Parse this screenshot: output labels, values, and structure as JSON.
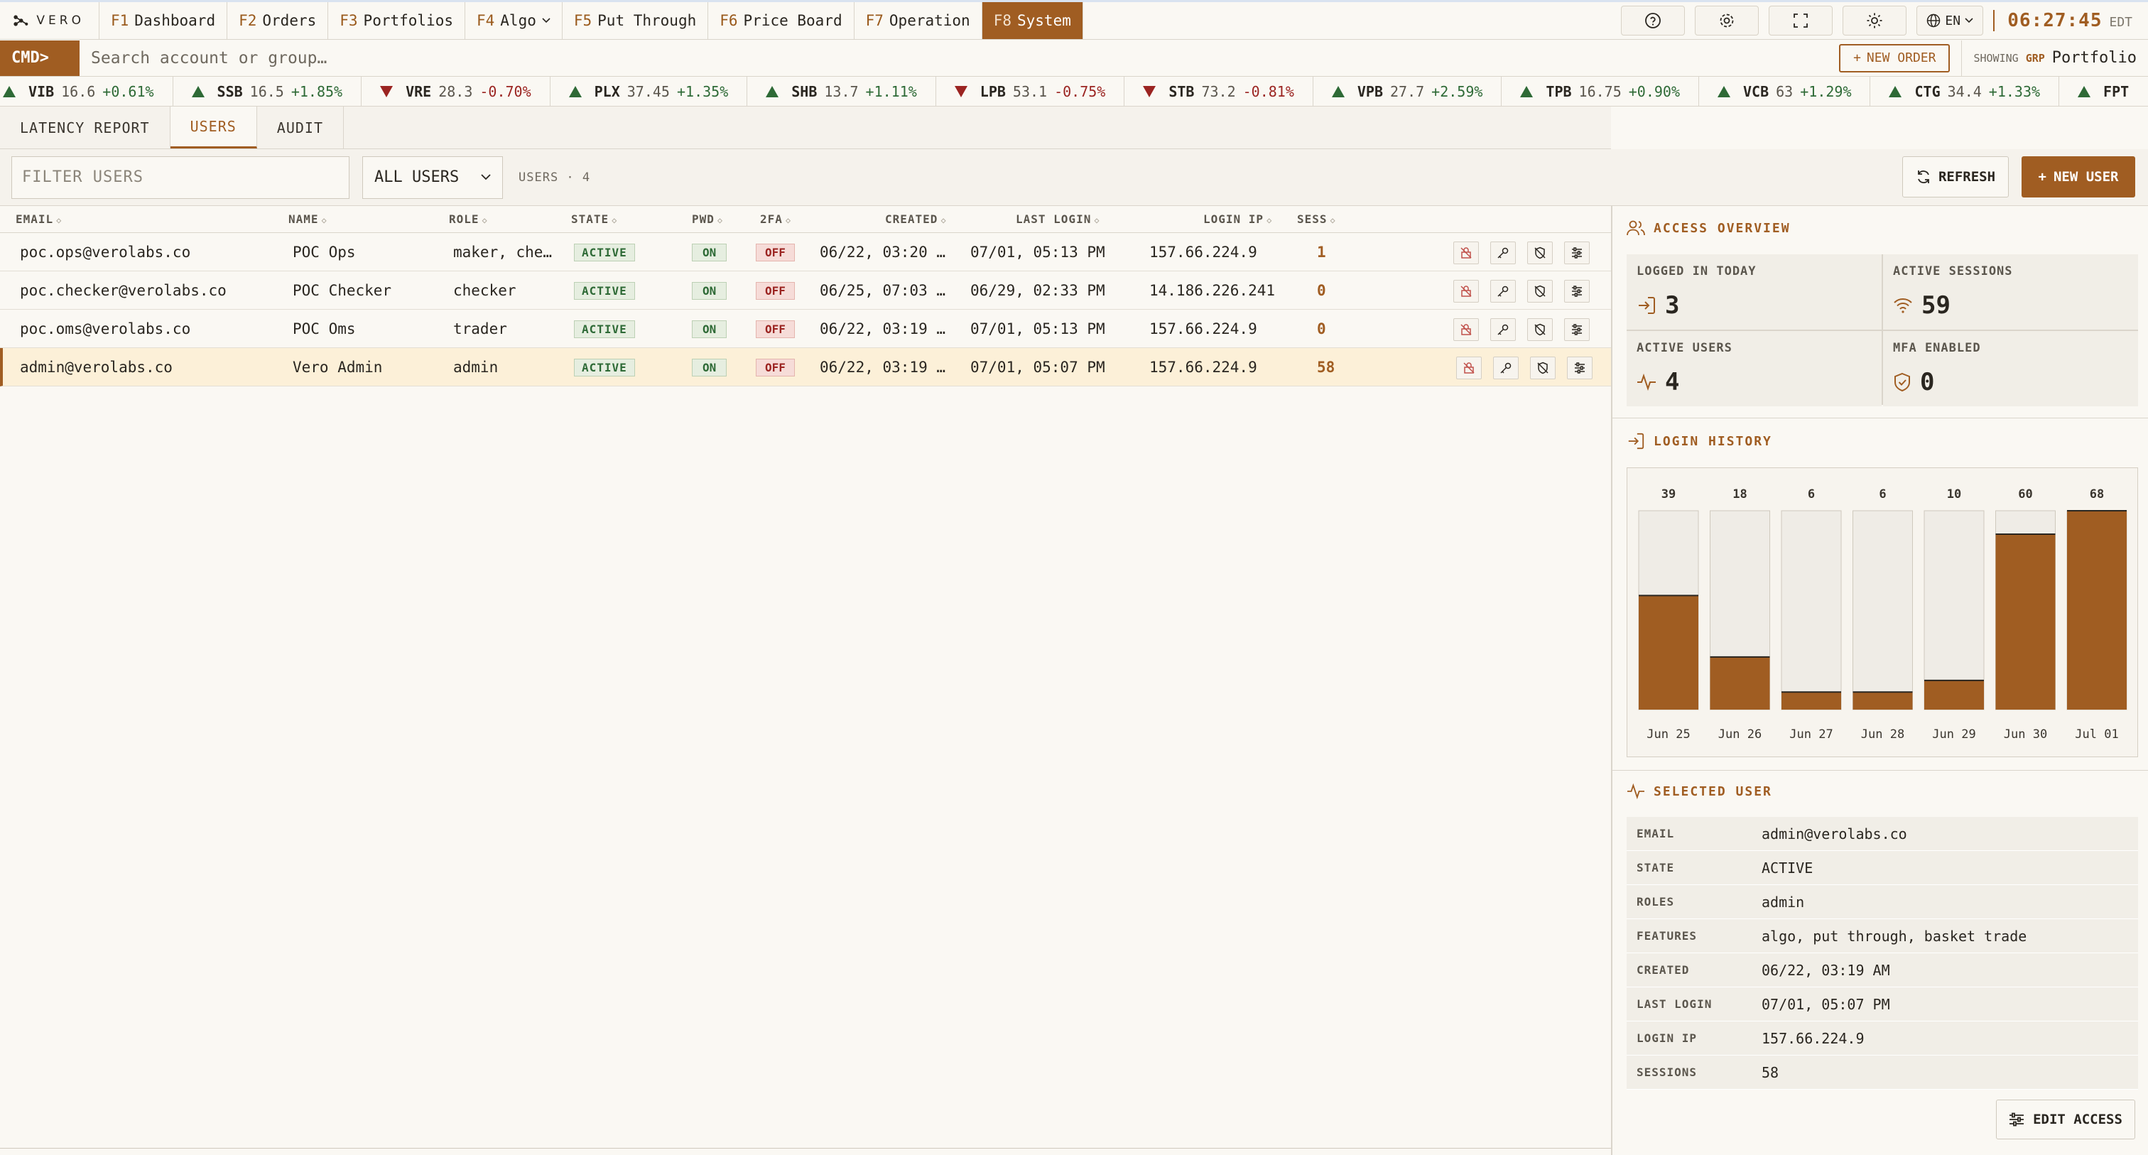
{
  "app": {
    "logo_text": "VERO"
  },
  "nav": {
    "tabs": [
      {
        "key": "F1",
        "label": "Dashboard"
      },
      {
        "key": "F2",
        "label": "Orders"
      },
      {
        "key": "F3",
        "label": "Portfolios"
      },
      {
        "key": "F4",
        "label": "Algo"
      },
      {
        "key": "F5",
        "label": "Put Through"
      },
      {
        "key": "F6",
        "label": "Price Board"
      },
      {
        "key": "F7",
        "label": "Operation"
      },
      {
        "key": "F8",
        "label": "System"
      }
    ],
    "language": "EN",
    "time": "06:27:45",
    "timezone": "EDT"
  },
  "cmd": {
    "label": "CMD>",
    "placeholder": "Search account or group…",
    "new_order": "NEW ORDER",
    "showing_label": "SHOWING",
    "showing_grp": "GRP",
    "showing_value": "Portfolio"
  },
  "ticker": [
    {
      "sym": "VIB",
      "px": "16.6",
      "chg": "+0.61%",
      "dir": "up"
    },
    {
      "sym": "SSB",
      "px": "16.5",
      "chg": "+1.85%",
      "dir": "up"
    },
    {
      "sym": "VRE",
      "px": "28.3",
      "chg": "-0.70%",
      "dir": "down"
    },
    {
      "sym": "PLX",
      "px": "37.45",
      "chg": "+1.35%",
      "dir": "up"
    },
    {
      "sym": "SHB",
      "px": "13.7",
      "chg": "+1.11%",
      "dir": "up"
    },
    {
      "sym": "LPB",
      "px": "53.1",
      "chg": "-0.75%",
      "dir": "down"
    },
    {
      "sym": "STB",
      "px": "73.2",
      "chg": "-0.81%",
      "dir": "down"
    },
    {
      "sym": "VPB",
      "px": "27.7",
      "chg": "+2.59%",
      "dir": "up"
    },
    {
      "sym": "TPB",
      "px": "16.75",
      "chg": "+0.90%",
      "dir": "up"
    },
    {
      "sym": "VCB",
      "px": "63",
      "chg": "+1.29%",
      "dir": "up"
    },
    {
      "sym": "CTG",
      "px": "34.4",
      "chg": "+1.33%",
      "dir": "up"
    },
    {
      "sym": "FPT",
      "px": "",
      "chg": "",
      "dir": "up"
    }
  ],
  "subtabs": [
    "LATENCY REPORT",
    "USERS",
    "AUDIT"
  ],
  "filter": {
    "placeholder": "FILTER USERS",
    "select_value": "ALL USERS",
    "count_text": "USERS · 4",
    "refresh": "REFRESH",
    "new_user": "NEW USER"
  },
  "table": {
    "headers": [
      "EMAIL",
      "NAME",
      "ROLE",
      "STATE",
      "PWD",
      "2FA",
      "CREATED",
      "LAST LOGIN",
      "LOGIN IP",
      "SESS"
    ],
    "rows": [
      {
        "email": "poc.ops@verolabs.co",
        "name": "POC Ops",
        "role": "maker, che…",
        "state": "ACTIVE",
        "pwd": "ON",
        "tfa": "OFF",
        "created": "06/22, 03:20 …",
        "last_login": "07/01, 05:13 PM",
        "ip": "157.66.224.9",
        "sess": "1"
      },
      {
        "email": "poc.checker@verolabs.co",
        "name": "POC Checker",
        "role": "checker",
        "state": "ACTIVE",
        "pwd": "ON",
        "tfa": "OFF",
        "created": "06/25, 07:03 …",
        "last_login": "06/29, 02:33 PM",
        "ip": "14.186.226.241",
        "sess": "0"
      },
      {
        "email": "poc.oms@verolabs.co",
        "name": "POC Oms",
        "role": "trader",
        "state": "ACTIVE",
        "pwd": "ON",
        "tfa": "OFF",
        "created": "06/22, 03:19 …",
        "last_login": "07/01, 05:13 PM",
        "ip": "157.66.224.9",
        "sess": "0"
      },
      {
        "email": "admin@verolabs.co",
        "name": "Vero Admin",
        "role": "admin",
        "state": "ACTIVE",
        "pwd": "ON",
        "tfa": "OFF",
        "created": "06/22, 03:19 …",
        "last_login": "07/01, 05:07 PM",
        "ip": "157.66.224.9",
        "sess": "58"
      }
    ],
    "selected_index": 3
  },
  "overview": {
    "title": "ACCESS OVERVIEW",
    "stats": [
      {
        "label": "LOGGED IN TODAY",
        "value": "3",
        "icon": "login-icon"
      },
      {
        "label": "ACTIVE SESSIONS",
        "value": "59",
        "icon": "wifi-icon"
      },
      {
        "label": "ACTIVE USERS",
        "value": "4",
        "icon": "pulse-icon"
      },
      {
        "label": "MFA ENABLED",
        "value": "0",
        "icon": "shield-icon"
      }
    ]
  },
  "history": {
    "title": "LOGIN HISTORY"
  },
  "chart_data": {
    "type": "bar",
    "categories": [
      "Jun 25",
      "Jun 26",
      "Jun 27",
      "Jun 28",
      "Jun 29",
      "Jun 30",
      "Jul 01"
    ],
    "values": [
      39,
      18,
      6,
      6,
      10,
      60,
      68
    ],
    "ylim": [
      0,
      68
    ],
    "title": "LOGIN HISTORY",
    "xlabel": "",
    "ylabel": "",
    "grid": false
  },
  "selected_user": {
    "title": "SELECTED USER",
    "fields": [
      {
        "k": "EMAIL",
        "v": "admin@verolabs.co"
      },
      {
        "k": "STATE",
        "v": "ACTIVE"
      },
      {
        "k": "ROLES",
        "v": "admin"
      },
      {
        "k": "FEATURES",
        "v": "algo, put through, basket trade"
      },
      {
        "k": "CREATED",
        "v": "06/22, 03:19 AM"
      },
      {
        "k": "LAST LOGIN",
        "v": "07/01, 05:07 PM"
      },
      {
        "k": "LOGIN IP",
        "v": "157.66.224.9"
      },
      {
        "k": "SESSIONS",
        "v": "58"
      }
    ],
    "edit": "EDIT ACCESS"
  },
  "colors": {
    "accent": "#a05d22",
    "up": "#2e6a36",
    "down": "#9b2421"
  }
}
